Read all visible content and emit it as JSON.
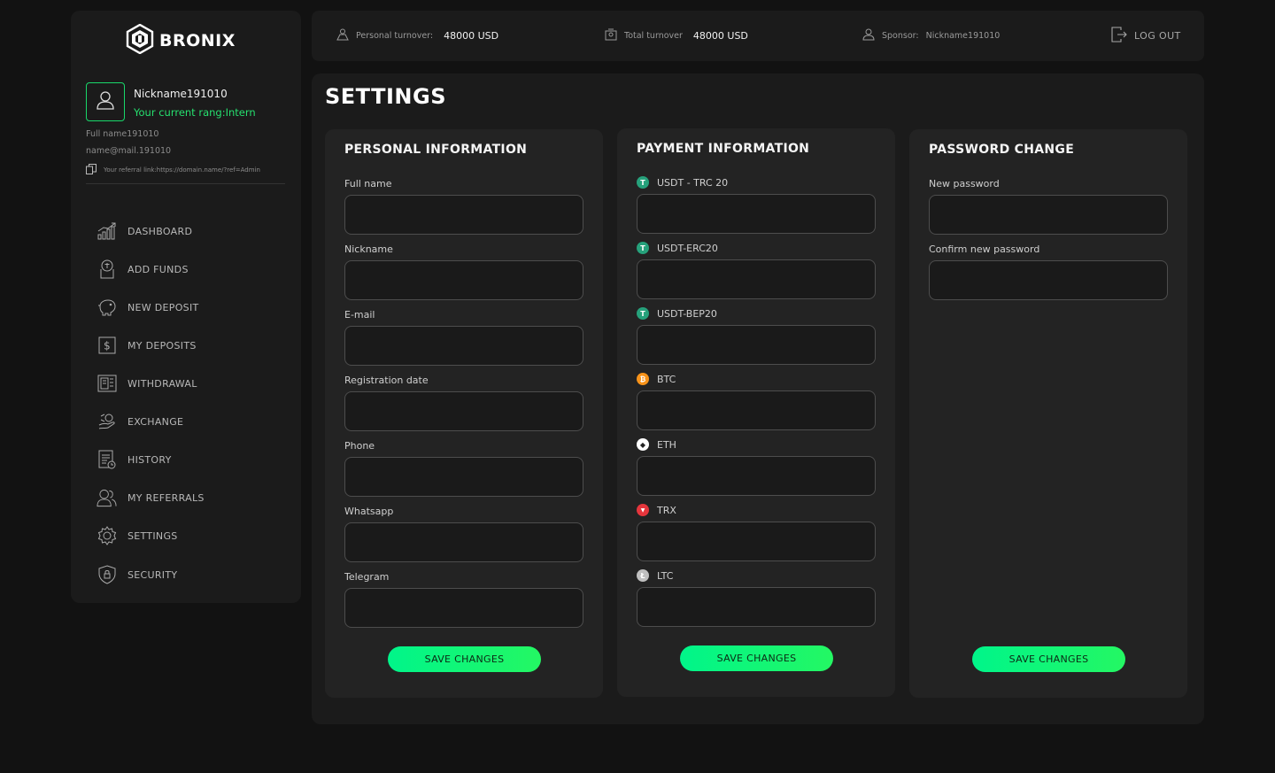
{
  "brand": {
    "name": "BRONIX"
  },
  "profile": {
    "nickname": "Nickname191010",
    "rang": "Your current rang:Intern",
    "full_name": "Full name191010",
    "email": "name@mail.191010",
    "referral": "Your referral link:https://domain.name/?ref=Admin"
  },
  "nav": [
    {
      "label": "DASHBOARD",
      "icon": "chart-icon"
    },
    {
      "label": "ADD FUNDS",
      "icon": "add-funds-icon"
    },
    {
      "label": "NEW DEPOSIT",
      "icon": "piggy-bank-icon"
    },
    {
      "label": "MY DEPOSITS",
      "icon": "dollar-icon"
    },
    {
      "label": "WITHDRAWAL",
      "icon": "atm-icon"
    },
    {
      "label": "EXCHANGE",
      "icon": "exchange-icon"
    },
    {
      "label": "HISTORY",
      "icon": "history-icon"
    },
    {
      "label": "MY REFERRALS",
      "icon": "referrals-icon"
    },
    {
      "label": "SETTINGS",
      "icon": "gear-icon"
    },
    {
      "label": "SECURITY",
      "icon": "shield-icon"
    }
  ],
  "header": {
    "personal_turnover_label": "Personal turnover:",
    "personal_turnover_value": "48000 USD",
    "total_turnover_label": "Total turnover",
    "total_turnover_value": "48000 USD",
    "sponsor_label": "Sponsor:",
    "sponsor_value": "Nickname191010",
    "logout_label": "LOG OUT"
  },
  "page_title": "SETTINGS",
  "personal": {
    "title": "PERSONAL INFORMATION",
    "fields": [
      {
        "label": "Full name",
        "value": ""
      },
      {
        "label": "Nickname",
        "value": ""
      },
      {
        "label": "E-mail",
        "value": ""
      },
      {
        "label": "Registration date",
        "value": ""
      },
      {
        "label": "Phone",
        "value": ""
      },
      {
        "label": "Whatsapp",
        "value": ""
      },
      {
        "label": "Telegram",
        "value": ""
      }
    ],
    "save_label": "SAVE CHANGES"
  },
  "payment": {
    "title": "PAYMENT INFORMATION",
    "fields": [
      {
        "label": "USDT - TRC 20",
        "coin": "T",
        "color": "#26a17b",
        "value": ""
      },
      {
        "label": "USDT-ERC20",
        "coin": "T",
        "color": "#26a17b",
        "value": ""
      },
      {
        "label": "USDT-BEP20",
        "coin": "T",
        "color": "#26a17b",
        "value": ""
      },
      {
        "label": "BTC",
        "coin": "₿",
        "color": "#f7931a",
        "value": ""
      },
      {
        "label": "ETH",
        "coin": "◆",
        "color": "#ffffff",
        "value": ""
      },
      {
        "label": "TRX",
        "coin": "▼",
        "color": "#e5353c",
        "value": ""
      },
      {
        "label": "LTC",
        "coin": "Ł",
        "color": "#bfbfbf",
        "value": ""
      }
    ],
    "save_label": "SAVE CHANGES"
  },
  "password": {
    "title": "PASSWORD CHANGE",
    "fields": [
      {
        "label": "New password",
        "value": ""
      },
      {
        "label": "Confirm new password",
        "value": ""
      }
    ],
    "save_label": "SAVE CHANGES"
  },
  "colors": {
    "accent": "#1fe66c",
    "panel": "#1b1b1b",
    "card": "#232323",
    "background": "#121212"
  }
}
